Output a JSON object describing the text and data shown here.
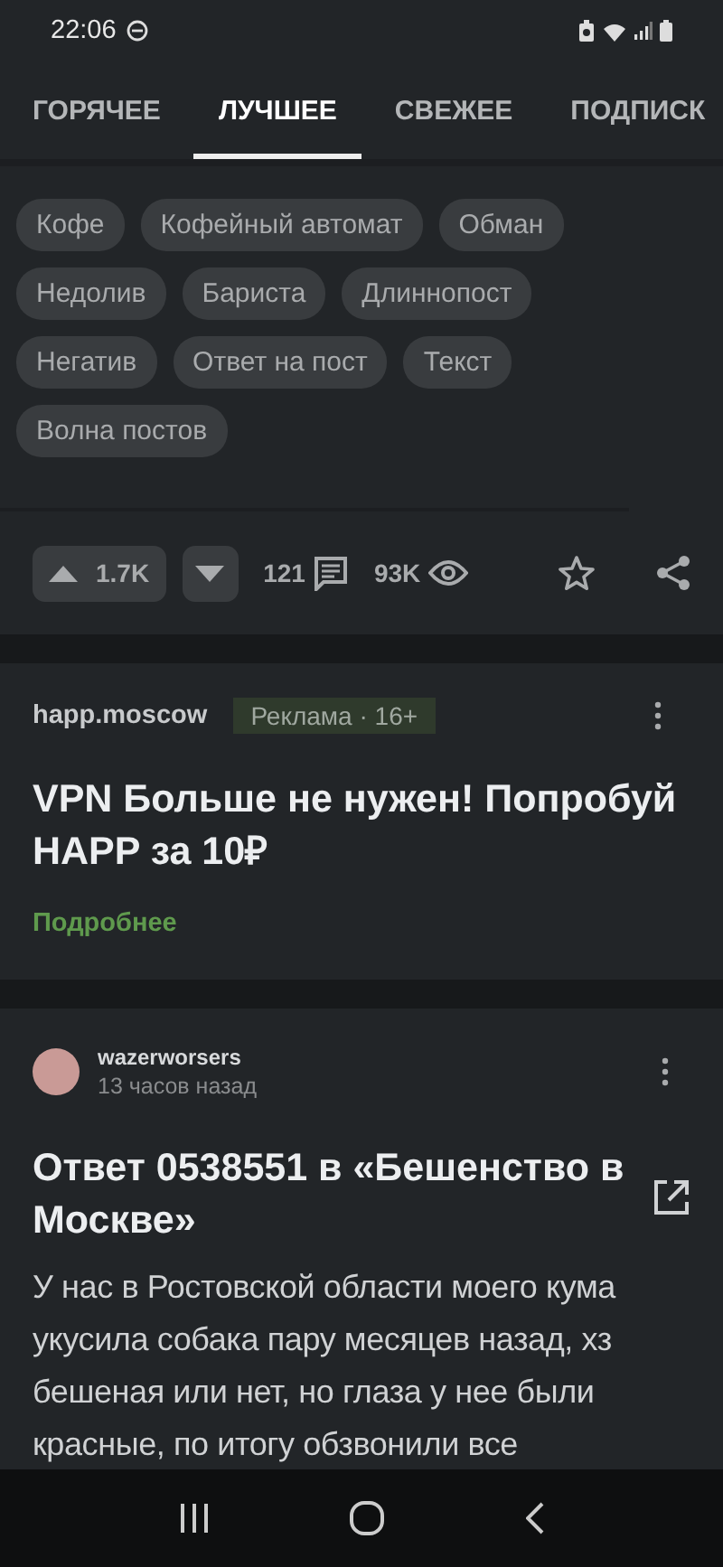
{
  "status_bar": {
    "time": "22:06"
  },
  "tabs": [
    {
      "label": "ГОРЯЧЕЕ",
      "selected": false
    },
    {
      "label": "ЛУЧШЕЕ",
      "selected": true
    },
    {
      "label": "СВЕЖЕЕ",
      "selected": false
    },
    {
      "label": "ПОДПИСК",
      "selected": false
    }
  ],
  "tags": [
    "Кофе",
    "Кофейный автомат",
    "Обман",
    "Недолив",
    "Бариста",
    "Длиннопост",
    "Негатив",
    "Ответ на пост",
    "Текст",
    "Волна постов"
  ],
  "actions": {
    "rating": "1.7K",
    "comments": "121",
    "views": "93K"
  },
  "ad": {
    "source": "happ.moscow",
    "label": "Реклама · 16+",
    "title": "VPN Больше не нужен! Попробуй HAPP за 10₽",
    "link": "Подробнее"
  },
  "post": {
    "author": "wazerworsers",
    "time": "13 часов назад",
    "title": "Ответ 0538551 в «Бешенство в Москве»",
    "body": "У нас в Ростовской области моего кума укусила собака пару месяцев назад, хз бешеная или нет, но глаза у нее были красные, по итогу обзвонили все"
  }
}
